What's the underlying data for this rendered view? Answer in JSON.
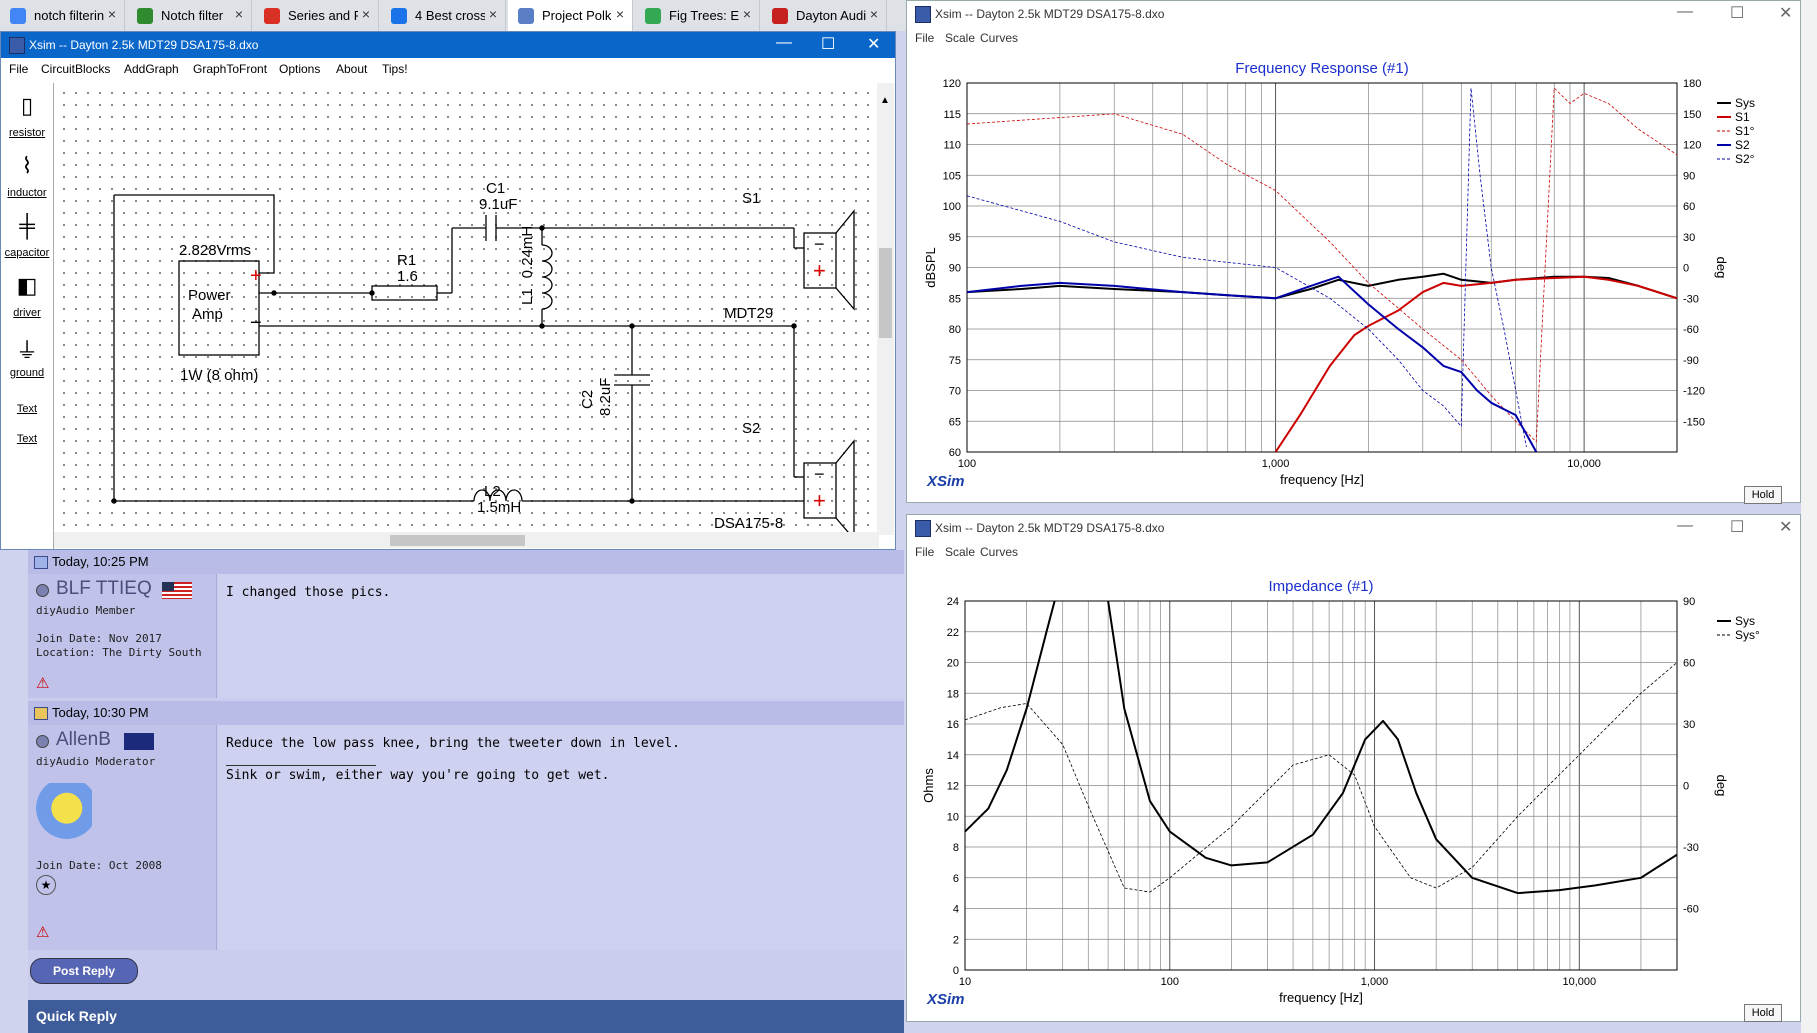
{
  "browser": {
    "tabs": [
      {
        "label": "notch filterin",
        "color": "#4285f4"
      },
      {
        "label": "Notch filter",
        "color": "#2e8b2e"
      },
      {
        "label": "Series and P",
        "color": "#d93025"
      },
      {
        "label": "4 Best cross",
        "color": "#1a73e8"
      },
      {
        "label": "Project Polk",
        "color": "#5b7fc7",
        "active": true
      },
      {
        "label": "Fig Trees: Ev",
        "color": "#34a853"
      },
      {
        "label": "Dayton Audi",
        "color": "#c5221f"
      }
    ],
    "close_glyph": "×"
  },
  "schematic_window": {
    "title": "Xsim -- Dayton 2.5k MDT29 DSA175-8.dxo",
    "menu": [
      "File",
      "CircuitBlocks",
      "AddGraph",
      "GraphToFront",
      "Options",
      "About",
      "Tips!"
    ],
    "tools": [
      "resistor",
      "inductor",
      "capacitor",
      "driver",
      "ground",
      "Text",
      "Text"
    ],
    "components": {
      "amp_voltage": "2.828Vrms",
      "amp_label_1": "Power",
      "amp_label_2": "Amp",
      "amp_power": "1W (8 ohm)",
      "c1_name": "C1",
      "c1_value": "9.1uF",
      "r1_name": "R1",
      "r1_value": "1.6",
      "l1_name": "L1",
      "l1_value": "0.24mH",
      "c2_name": "C2",
      "c2_value": "8.2uF",
      "l2_name": "L2",
      "l2_value": "1.5mH",
      "s1_name": "S1",
      "s1_model": "MDT29",
      "s2_name": "S2",
      "s2_model": "DSA175-8",
      "plus": "+",
      "minus": "−"
    }
  },
  "forum": {
    "posts": [
      {
        "time": "Today, 10:25 PM",
        "user": "BLF TTIEQ",
        "role": "diyAudio Member",
        "join": "Join Date: Nov 2017",
        "location": "Location: The Dirty South",
        "message": "I changed those pics."
      },
      {
        "time": "Today, 10:30 PM",
        "user": "AllenB",
        "role": "diyAudio Moderator",
        "join": "Join Date: Oct 2008",
        "message": "Reduce the low pass knee, bring the tweeter down in level.",
        "signature": "Sink or swim, either way you're going to get wet."
      }
    ],
    "post_reply": "Post Reply",
    "quick_reply": "Quick Reply"
  },
  "freq_window": {
    "title": "Xsim -- Dayton 2.5k MDT29 DSA175-8.dxo",
    "menu": [
      "File",
      "Scale",
      "Curves"
    ],
    "hold": "Hold",
    "brand": "XSim"
  },
  "imp_window": {
    "title": "Xsim -- Dayton 2.5k MDT29 DSA175-8.dxo",
    "menu": [
      "File",
      "Scale",
      "Curves"
    ],
    "hold": "Hold",
    "brand": "XSim"
  },
  "chart_data": [
    {
      "type": "line",
      "title": "Frequency Response (#1)",
      "xlabel": "frequency [Hz]",
      "ylabel": "dBSPL",
      "y2label": "deg",
      "xscale": "log",
      "xlim": [
        100,
        20000
      ],
      "ylim": [
        60,
        120
      ],
      "y2lim": [
        -180,
        180
      ],
      "xticks": [
        "100",
        "1,000",
        "10,000"
      ],
      "yticks": [
        60,
        65,
        70,
        75,
        80,
        85,
        90,
        95,
        100,
        105,
        110,
        115,
        120
      ],
      "y2ticks": [
        -150,
        -120,
        -90,
        -60,
        -30,
        0,
        30,
        60,
        90,
        120,
        150,
        180
      ],
      "legend_position": "top-right",
      "grid": true,
      "series": [
        {
          "name": "Sys",
          "color": "#000000",
          "width": 2,
          "dash": false,
          "axis": "left",
          "x": [
            100,
            150,
            200,
            300,
            500,
            700,
            1000,
            1300,
            1600,
            2000,
            2500,
            3000,
            3500,
            4000,
            5000,
            6000,
            8000,
            10000,
            12000,
            15000,
            20000
          ],
          "y": [
            86,
            86.5,
            87,
            86.5,
            86,
            85.5,
            85,
            86.5,
            88,
            87,
            88,
            88.5,
            89,
            88,
            87.5,
            88,
            88.5,
            88.5,
            88.3,
            87,
            85
          ]
        },
        {
          "name": "S1",
          "color": "#cc0000",
          "width": 2,
          "dash": false,
          "axis": "left",
          "x": [
            1000,
            1200,
            1500,
            1800,
            2000,
            2500,
            3000,
            3500,
            4000,
            5000,
            6000,
            8000,
            10000,
            12000,
            15000,
            20000
          ],
          "y": [
            60,
            66,
            74,
            79,
            80.5,
            83,
            86,
            87.5,
            87,
            87.5,
            88,
            88.3,
            88.5,
            88,
            87,
            85
          ]
        },
        {
          "name": "S1°",
          "color": "#cc0000",
          "width": 0.8,
          "dash": true,
          "axis": "right",
          "x": [
            100,
            300,
            500,
            700,
            1000,
            1500,
            2000,
            3000,
            4000,
            5000,
            6000,
            7000,
            8000,
            9000,
            10000,
            12000,
            15000,
            20000
          ],
          "y": [
            140,
            150,
            130,
            100,
            75,
            25,
            -15,
            -60,
            -90,
            -125,
            -150,
            -170,
            175,
            160,
            170,
            160,
            135,
            110
          ]
        },
        {
          "name": "S2",
          "color": "#0000aa",
          "width": 2,
          "dash": false,
          "axis": "left",
          "x": [
            100,
            150,
            200,
            300,
            500,
            700,
            1000,
            1300,
            1600,
            2000,
            2500,
            3000,
            3500,
            4000,
            4500,
            5000,
            6000,
            7000
          ],
          "y": [
            86,
            87,
            87.5,
            87,
            86,
            85.5,
            85,
            87,
            88.5,
            84,
            80,
            77,
            74,
            73,
            70,
            68,
            66,
            60
          ]
        },
        {
          "name": "S2°",
          "color": "#0000aa",
          "width": 0.8,
          "dash": true,
          "axis": "right",
          "x": [
            100,
            200,
            300,
            500,
            700,
            1000,
            1500,
            2000,
            2500,
            3000,
            3500,
            4000,
            4300,
            4600,
            5000,
            5500,
            6000,
            6500
          ],
          "y": [
            70,
            45,
            25,
            10,
            5,
            0,
            -30,
            -60,
            -90,
            -120,
            -135,
            -155,
            175,
            90,
            0,
            -60,
            -120,
            -175
          ]
        }
      ]
    },
    {
      "type": "line",
      "title": "Impedance (#1)",
      "xlabel": "frequency [Hz]",
      "ylabel": "Ohms",
      "y2label": "deg",
      "xscale": "log",
      "xlim": [
        10,
        30000
      ],
      "ylim": [
        0,
        24
      ],
      "y2lim": [
        -90,
        90
      ],
      "xticks": [
        "10",
        "100",
        "1,000",
        "10,000"
      ],
      "yticks": [
        0,
        2,
        4,
        6,
        8,
        10,
        12,
        14,
        16,
        18,
        20,
        22,
        24
      ],
      "y2ticks": [
        -60,
        -30,
        0,
        30,
        60,
        90
      ],
      "legend_position": "top-right",
      "grid": true,
      "series": [
        {
          "name": "Sys",
          "color": "#000000",
          "width": 2,
          "dash": false,
          "axis": "left",
          "x": [
            10,
            13,
            16,
            20,
            25,
            30,
            40,
            50,
            60,
            80,
            100,
            150,
            200,
            300,
            500,
            700,
            900,
            1100,
            1300,
            1600,
            2000,
            3000,
            5000,
            8000,
            12000,
            20000,
            30000
          ],
          "y": [
            9,
            10.5,
            13,
            17,
            22,
            26,
            27,
            24,
            17,
            11,
            9,
            7.3,
            6.8,
            7,
            8.8,
            11.5,
            15,
            16.2,
            15,
            11.5,
            8.5,
            6,
            5,
            5.2,
            5.5,
            6,
            7.5
          ]
        },
        {
          "name": "Sys°",
          "color": "#000000",
          "width": 0.8,
          "dash": true,
          "axis": "right",
          "x": [
            10,
            15,
            20,
            30,
            40,
            60,
            80,
            100,
            200,
            400,
            600,
            800,
            1000,
            1500,
            2000,
            3000,
            5000,
            10000,
            20000,
            30000
          ],
          "y": [
            32,
            38,
            40,
            20,
            -10,
            -50,
            -52,
            -45,
            -20,
            10,
            15,
            5,
            -20,
            -45,
            -50,
            -40,
            -15,
            15,
            45,
            60
          ]
        }
      ]
    }
  ]
}
